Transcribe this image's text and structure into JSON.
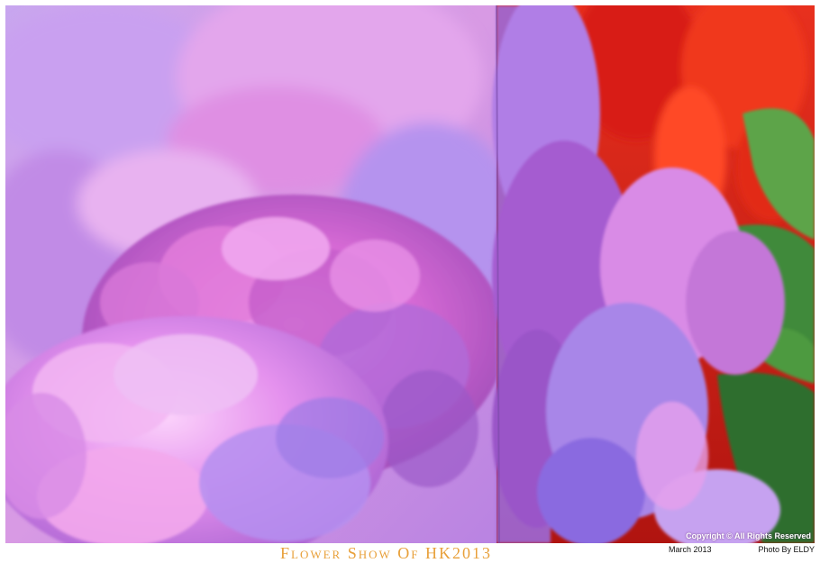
{
  "photo": {
    "subject": "hydrangea-flowers-photo",
    "colors": {
      "hydrangea_pink": "#e07ad8",
      "hydrangea_violet": "#9b72e0",
      "background_red": "#e0261a",
      "leaf_green": "#3f8a3a"
    },
    "copyright": "Copyright © All Rights Reserved"
  },
  "caption": {
    "show_title": "Flower Show Of HK2013",
    "date": "March 2013",
    "credit": "Photo By ELDY",
    "title_color": "#e8a03a"
  }
}
